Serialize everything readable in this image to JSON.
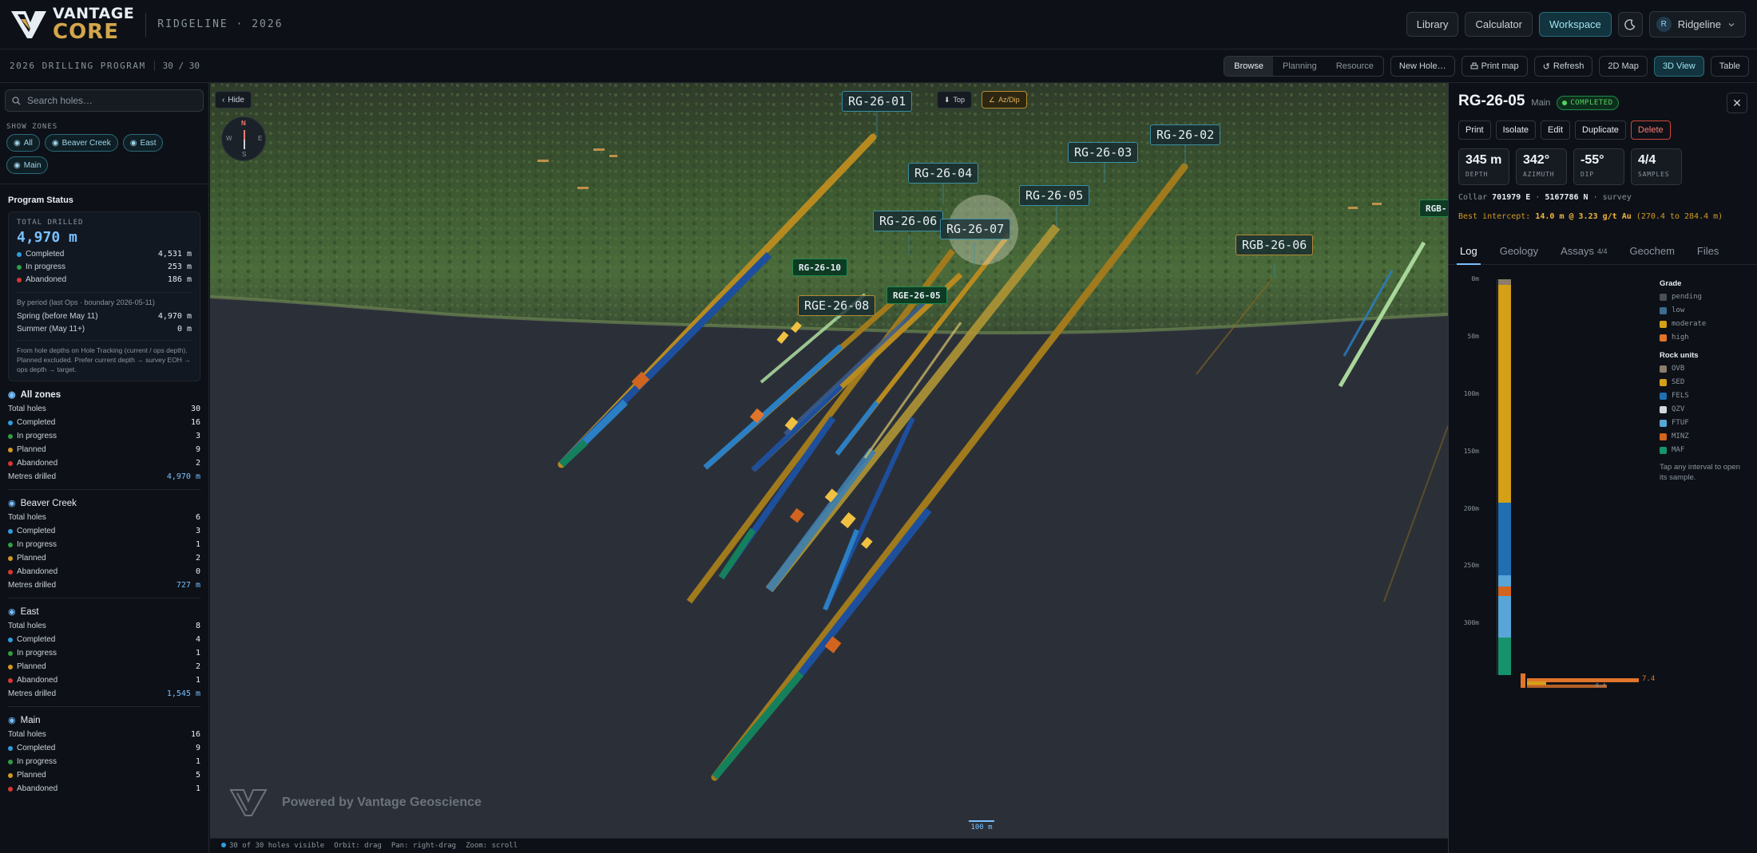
{
  "app": {
    "project": "RIDGELINE · 2026"
  },
  "topnav": {
    "library": "Library",
    "calculator": "Calculator",
    "workspace": "Workspace",
    "user": "Ridgeline",
    "user_initial": "R"
  },
  "subbar": {
    "program_title": "2026 DRILLING PROGRAM",
    "program_count": "30 / 30",
    "modes": [
      "Browse",
      "Planning",
      "Resource"
    ],
    "new_hole": "New Hole…",
    "print_map": "Print map",
    "refresh": "Refresh",
    "map2d": "2D Map",
    "view3d": "3D View",
    "table": "Table"
  },
  "sidebar": {
    "search_placeholder": "Search holes…",
    "show_zones_label": "SHOW ZONES",
    "zone_chips": [
      "All",
      "Beaver Creek",
      "East",
      "Main"
    ],
    "status_title": "Program Status",
    "total_drilled_label": "TOTAL DRILLED",
    "total_drilled_value": "4,970 m",
    "status_rows": [
      {
        "label": "Completed",
        "value": "4,531 m"
      },
      {
        "label": "In progress",
        "value": "253 m"
      },
      {
        "label": "Abandoned",
        "value": "186 m"
      }
    ],
    "period_note": "By period (last Ops · boundary 2026-05-11)",
    "period_rows": [
      {
        "label": "Spring (before May 11)",
        "value": "4,970 m"
      },
      {
        "label": "Summer (May 11+)",
        "value": "0 m"
      }
    ],
    "foot_note": "From hole depths on Hole Tracking (current / ops depth). Planned excluded. Prefer current depth → survey EOH → ops depth → target.",
    "zones": [
      {
        "name": "All zones",
        "total_label": "Total holes",
        "total": "30",
        "completed": "16",
        "in_progress": "3",
        "planned": "9",
        "abandoned": "2",
        "metres_label": "Metres drilled",
        "metres": "4,970 m"
      },
      {
        "name": "Beaver Creek",
        "total_label": "Total holes",
        "total": "6",
        "completed": "3",
        "in_progress": "1",
        "planned": "2",
        "abandoned": "0",
        "metres_label": "Metres drilled",
        "metres": "727 m"
      },
      {
        "name": "East",
        "total_label": "Total holes",
        "total": "8",
        "completed": "4",
        "in_progress": "1",
        "planned": "2",
        "abandoned": "1",
        "metres_label": "Metres drilled",
        "metres": "1,545 m"
      },
      {
        "name": "Main",
        "total_label": "Total holes",
        "total": "16",
        "completed": "9",
        "in_progress": "1",
        "planned": "5",
        "abandoned": "1"
      }
    ],
    "row_labels": {
      "completed": "Completed",
      "in_progress": "In progress",
      "planned": "Planned",
      "abandoned": "Abandoned"
    }
  },
  "viewport": {
    "hide": "Hide",
    "view_top": "Top",
    "view_azdip": "Az/Dip",
    "compass": {
      "n": "N",
      "s": "S",
      "e": "E",
      "w": "W"
    },
    "labels": [
      "RG-26-01",
      "RG-26-02",
      "RG-26-03",
      "RG-26-04",
      "RG-26-05",
      "RG-26-06",
      "RG-26-07",
      "RGE-26-08",
      "RGB-26-06",
      "RG-26-10",
      "RGE-26-05",
      "RGB-"
    ],
    "watermark": "Powered by Vantage Geoscience",
    "scale": "100 m",
    "status_visible": "30 of 30 holes visible",
    "status_orbit": "Orbit: drag",
    "status_pan": "Pan: right-drag",
    "status_zoom": "Zoom: scroll"
  },
  "panel": {
    "hole_id": "RG-26-05",
    "zone": "Main",
    "status": "COMPLETED",
    "actions": [
      "Print",
      "Isolate",
      "Edit",
      "Duplicate",
      "Delete"
    ],
    "metrics": [
      {
        "value": "345 m",
        "label": "DEPTH"
      },
      {
        "value": "342°",
        "label": "AZIMUTH"
      },
      {
        "value": "-55°",
        "label": "DIP"
      },
      {
        "value": "4/4",
        "label": "SAMPLES"
      }
    ],
    "collar_label": "Collar",
    "collar_e": "701979 E",
    "collar_n": "5167786 N",
    "collar_src": "· survey",
    "intercept_label": "Best intercept:",
    "intercept_value": "14.0 m @ 3.23 g/t Au",
    "intercept_range": "(270.4 to 284.4 m)",
    "tabs": [
      "Log",
      "Geology",
      "Assays",
      "Geochem",
      "Files"
    ],
    "assays_count": "4/4",
    "depth_ticks": [
      "0m",
      "50m",
      "100m",
      "150m",
      "200m",
      "250m",
      "300m"
    ],
    "grade_title": "Grade",
    "grades": [
      {
        "name": "pending",
        "color": "#484f58"
      },
      {
        "name": "low",
        "color": "#3b6e8f"
      },
      {
        "name": "moderate",
        "color": "#d4a017"
      },
      {
        "name": "high",
        "color": "#e0742a"
      }
    ],
    "rock_title": "Rock units",
    "rocks": [
      {
        "name": "OVB",
        "color": "#8b7d6b"
      },
      {
        "name": "SED",
        "color": "#d4a017"
      },
      {
        "name": "FELS",
        "color": "#1f6fb2"
      },
      {
        "name": "QZV",
        "color": "#d0d7de"
      },
      {
        "name": "FTUF",
        "color": "#58a6d8"
      },
      {
        "name": "MINZ",
        "color": "#d1641f"
      },
      {
        "name": "MAF",
        "color": "#17936b"
      }
    ],
    "note": "Tap any interval to open its sample.",
    "assay_value": "7.4",
    "assay_value_small": "6.4",
    "log_intervals": [
      {
        "unit": "OVB",
        "from": 0,
        "to": 5
      },
      {
        "unit": "SED",
        "from": 5,
        "to": 195
      },
      {
        "unit": "FELS",
        "from": 195,
        "to": 258
      },
      {
        "unit": "FTUF",
        "from": 258,
        "to": 268
      },
      {
        "unit": "MINZ",
        "from": 268,
        "to": 276
      },
      {
        "unit": "FTUF",
        "from": 276,
        "to": 312
      },
      {
        "unit": "MAF",
        "from": 312,
        "to": 345
      }
    ]
  },
  "colors": {
    "completed": "#2f9ee0",
    "in_progress": "#2ea043",
    "planned": "#d29922",
    "abandoned": "#da3633"
  }
}
